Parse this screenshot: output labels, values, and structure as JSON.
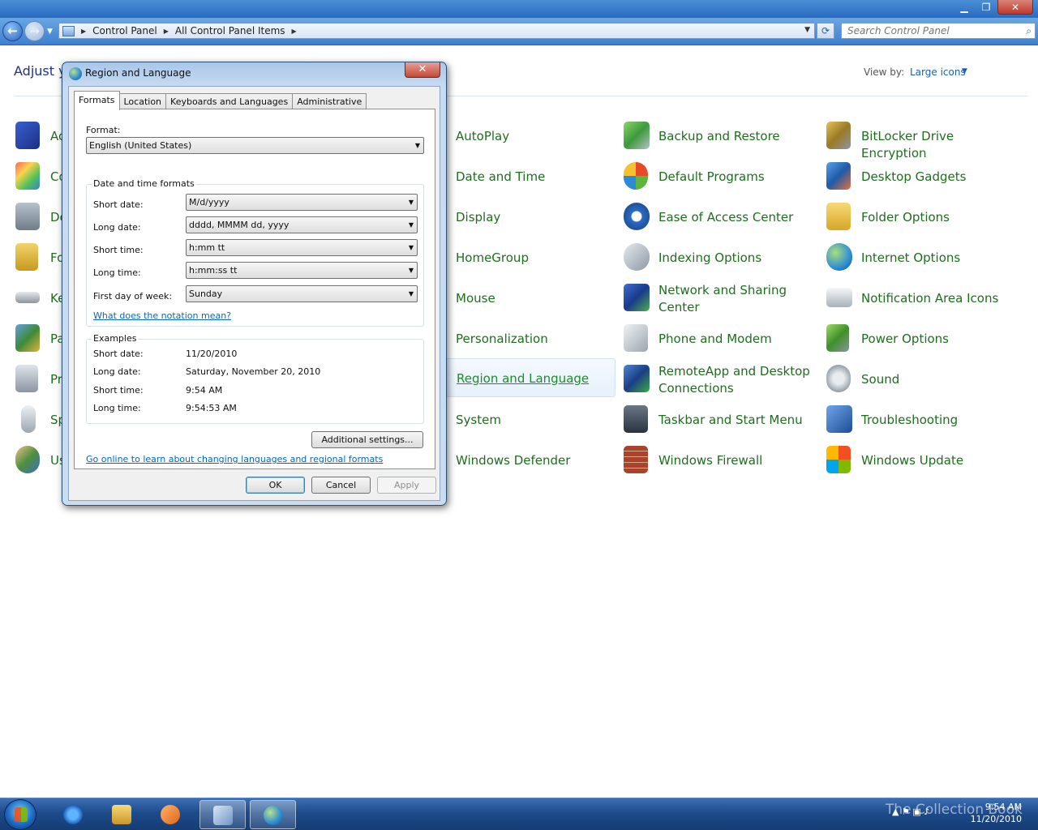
{
  "window": {
    "controls": {
      "minimize": "▁",
      "maximize": "❐",
      "close": "✕"
    }
  },
  "nav": {
    "back_glyph": "←",
    "forward_glyph": "→",
    "breadcrumbs": [
      "Control Panel",
      "All Control Panel Items"
    ],
    "search_placeholder": "Search Control Panel"
  },
  "header": {
    "title_partial": "Adjust y",
    "view_by_label": "View by:",
    "view_by_value": "Large icons"
  },
  "control_panel_items": [
    {
      "label": "Ac"
    },
    {
      "label": "Co"
    },
    {
      "label": "De"
    },
    {
      "label": "Fo"
    },
    {
      "label": "Ke"
    },
    {
      "label": "Pa"
    },
    {
      "label": "Pr"
    },
    {
      "label": "Sp"
    },
    {
      "label": "Us"
    },
    {
      "label": "AutoPlay"
    },
    {
      "label": "Date and Time"
    },
    {
      "label": "Display"
    },
    {
      "label": "HomeGroup"
    },
    {
      "label": "Mouse"
    },
    {
      "label": "Personalization"
    },
    {
      "label": "Region and Language"
    },
    {
      "label": "System"
    },
    {
      "label": "Windows Defender"
    },
    {
      "label": "Backup and Restore"
    },
    {
      "label": "Default Programs"
    },
    {
      "label": "Ease of Access Center"
    },
    {
      "label": "Indexing Options"
    },
    {
      "label": "Network and Sharing",
      "label2": "Center"
    },
    {
      "label": "Phone and Modem"
    },
    {
      "label": "RemoteApp and Desktop",
      "label2": "Connections"
    },
    {
      "label": "Taskbar and Start Menu"
    },
    {
      "label": "Windows Firewall"
    },
    {
      "label": "BitLocker Drive Encryption"
    },
    {
      "label": "Desktop Gadgets"
    },
    {
      "label": "Folder Options"
    },
    {
      "label": "Internet Options"
    },
    {
      "label": "Notification Area Icons"
    },
    {
      "label": "Power Options"
    },
    {
      "label": "Sound"
    },
    {
      "label": "Troubleshooting"
    },
    {
      "label": "Windows Update"
    }
  ],
  "dialog": {
    "title": "Region and Language",
    "close_glyph": "✕",
    "tabs": [
      "Formats",
      "Location",
      "Keyboards and Languages",
      "Administrative"
    ],
    "format_label": "Format:",
    "format_value": "English (United States)",
    "dt_group_title": "Date and time formats",
    "dt_rows": [
      {
        "label": "Short date:",
        "value": "M/d/yyyy"
      },
      {
        "label": "Long date:",
        "value": "dddd, MMMM dd, yyyy"
      },
      {
        "label": "Short time:",
        "value": "h:mm tt"
      },
      {
        "label": "Long time:",
        "value": "h:mm:ss tt"
      },
      {
        "label": "First day of week:",
        "value": "Sunday"
      }
    ],
    "notation_link": "What does the notation mean?",
    "examples_title": "Examples",
    "examples": [
      {
        "label": "Short date:",
        "value": "11/20/2010"
      },
      {
        "label": "Long date:",
        "value": "Saturday, November 20, 2010"
      },
      {
        "label": "Short time:",
        "value": "9:54 AM"
      },
      {
        "label": "Long time:",
        "value": "9:54:53 AM"
      }
    ],
    "additional_settings": "Additional settings...",
    "online_link": "Go online to learn about changing languages and regional formats",
    "ok": "OK",
    "cancel": "Cancel",
    "apply": "Apply"
  },
  "taskbar": {
    "watermark": "The Collection Book",
    "clock_time": "9:54 AM",
    "clock_date": "11/20/2010",
    "tray_glyphs": "▲ ⚑ ▣ ♪"
  },
  "colors": {
    "link_green": "#1e6e1e",
    "accent_blue": "#1e3287",
    "dialog_frame": "#c7dbf2"
  }
}
